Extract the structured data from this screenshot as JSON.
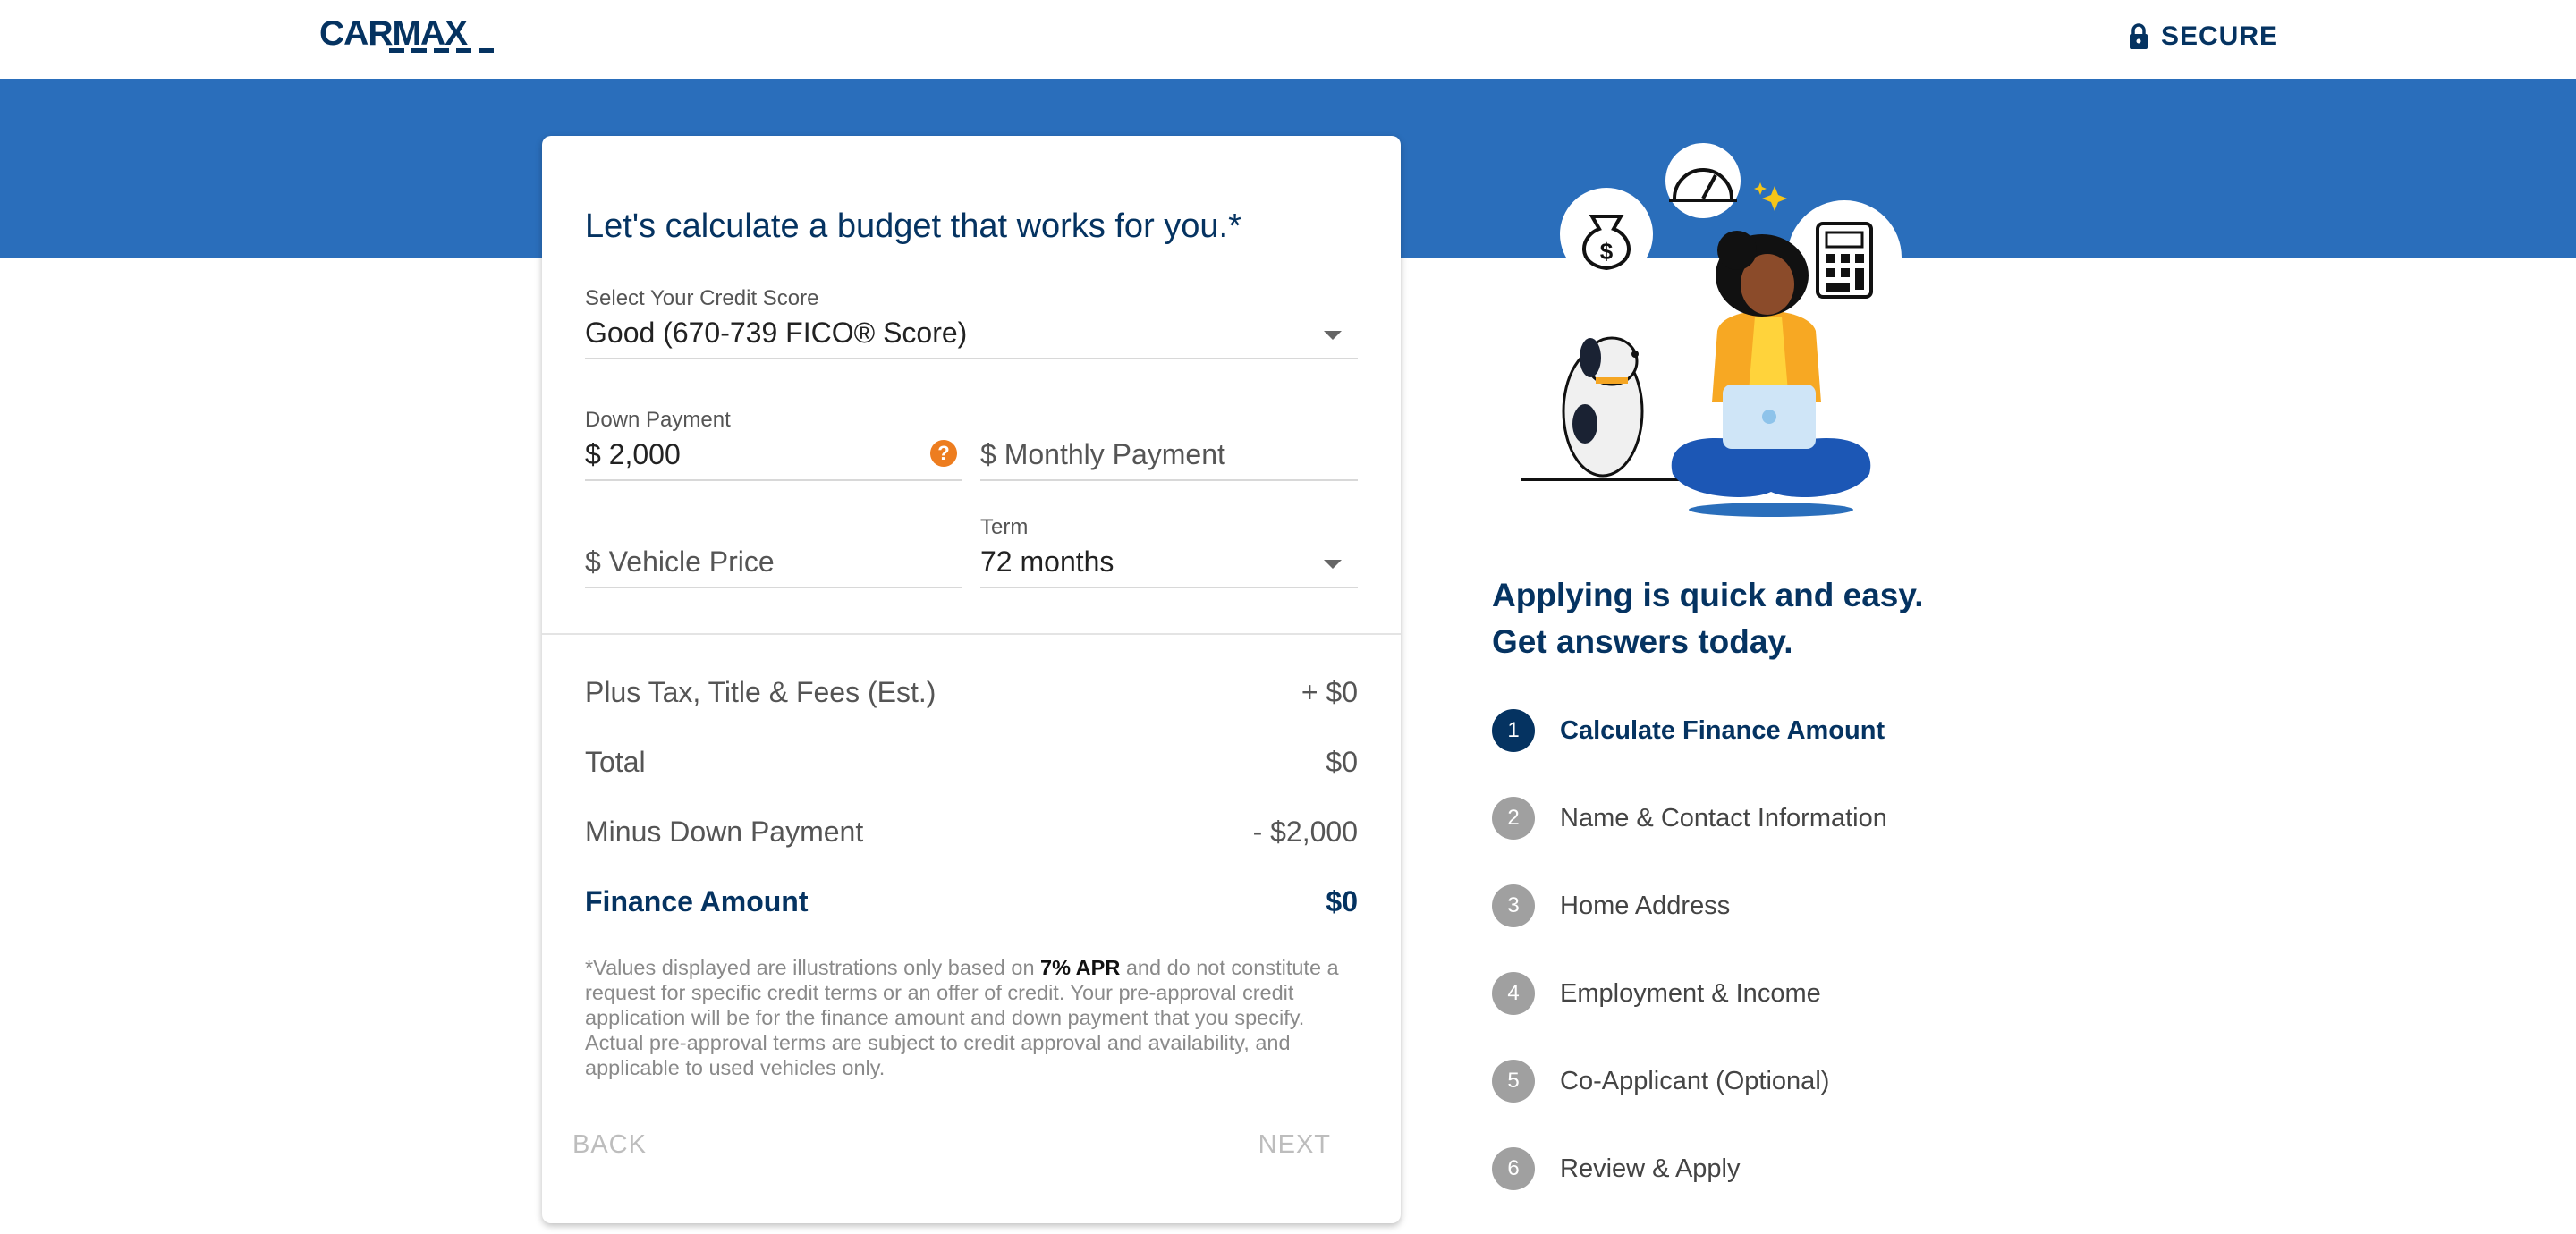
{
  "header": {
    "logo_text": "CARMAX",
    "secure_label": "SECURE"
  },
  "card": {
    "title": "Let's calculate a budget that works for you.*",
    "credit_score": {
      "label": "Select Your Credit Score",
      "value": "Good (670-739 FICO® Score)"
    },
    "down_payment": {
      "label": "Down Payment",
      "currency": "$",
      "value": "2,000",
      "help": "?"
    },
    "monthly_payment": {
      "currency": "$",
      "placeholder": "Monthly Payment"
    },
    "vehicle_price": {
      "currency": "$",
      "placeholder": "Vehicle Price"
    },
    "term": {
      "label": "Term",
      "value": "72 months"
    },
    "summary": [
      {
        "label": "Plus Tax, Title & Fees (Est.)",
        "value": "+ $0"
      },
      {
        "label": "Total",
        "value": "$0"
      },
      {
        "label": "Minus Down Payment",
        "value": "- $2,000"
      },
      {
        "label": "Finance Amount",
        "value": "$0"
      }
    ],
    "disclaimer": {
      "before": "*Values displayed are illustrations only based on ",
      "apr": "7% APR",
      "after": " and do not constitute a request for specific credit terms or an offer of credit. Your pre-approval credit application will be for the finance amount and down payment that you specify. Actual pre-approval terms are subject to credit approval and availability, and applicable to used vehicles only."
    },
    "back_label": "BACK",
    "next_label": "NEXT"
  },
  "sidebar": {
    "title_line1": "Applying is quick and easy.",
    "title_line2": "Get answers today.",
    "steps": [
      {
        "number": "1",
        "label": "Calculate Finance Amount",
        "active": true
      },
      {
        "number": "2",
        "label": "Name & Contact Information",
        "active": false
      },
      {
        "number": "3",
        "label": "Home Address",
        "active": false
      },
      {
        "number": "4",
        "label": "Employment & Income",
        "active": false
      },
      {
        "number": "5",
        "label": "Co-Applicant (Optional)",
        "active": false
      },
      {
        "number": "6",
        "label": "Review & Apply",
        "active": false
      }
    ]
  },
  "colors": {
    "brand_navy": "#053361",
    "band_blue": "#2a6ebb",
    "help_orange": "#ed7d1f",
    "step_inactive": "#a0a0a0"
  }
}
